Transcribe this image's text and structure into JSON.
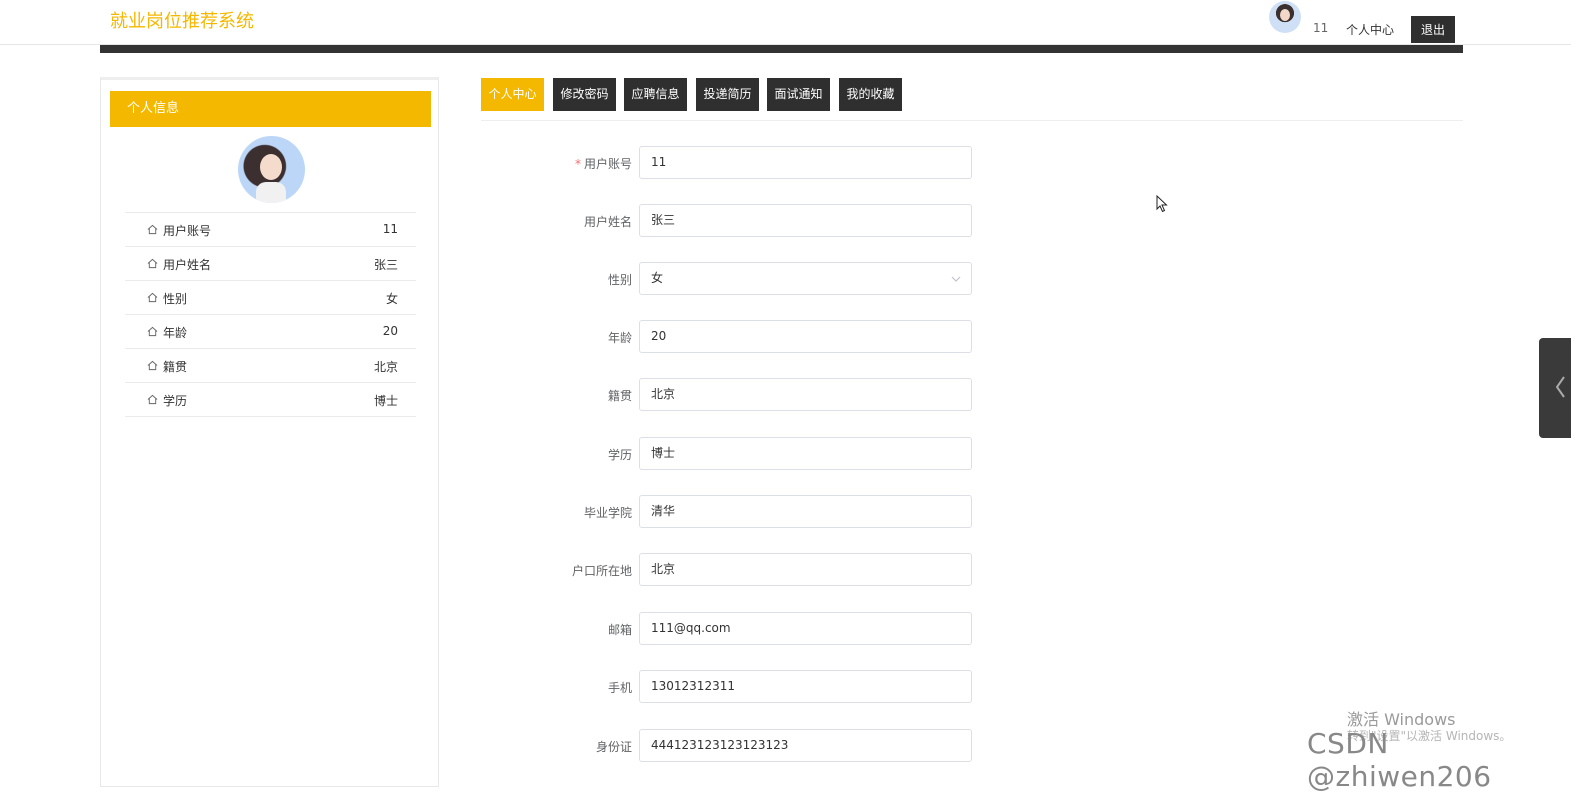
{
  "header": {
    "brand": "就业岗位推荐系统",
    "username": "11",
    "center_link": "个人中心",
    "logout_label": "退出"
  },
  "sidebar": {
    "title": "个人信息",
    "items": [
      {
        "label": "用户账号",
        "value": "11"
      },
      {
        "label": "用户姓名",
        "value": "张三"
      },
      {
        "label": "性别",
        "value": "女"
      },
      {
        "label": "年龄",
        "value": "20"
      },
      {
        "label": "籍贯",
        "value": "北京"
      },
      {
        "label": "学历",
        "value": "博士"
      }
    ]
  },
  "tabs": [
    {
      "label": "个人中心",
      "active": true
    },
    {
      "label": "修改密码",
      "active": false
    },
    {
      "label": "应聘信息",
      "active": false
    },
    {
      "label": "投递简历",
      "active": false
    },
    {
      "label": "面试通知",
      "active": false
    },
    {
      "label": "我的收藏",
      "active": false
    }
  ],
  "form": {
    "account": {
      "label": "用户账号",
      "required_mark": "*",
      "value": "11"
    },
    "name": {
      "label": "用户姓名",
      "value": "张三"
    },
    "gender": {
      "label": "性别",
      "value": "女"
    },
    "age": {
      "label": "年龄",
      "value": "20"
    },
    "native": {
      "label": "籍贯",
      "value": "北京"
    },
    "education": {
      "label": "学历",
      "value": "博士"
    },
    "school": {
      "label": "毕业学院",
      "value": "清华"
    },
    "hukou": {
      "label": "户口所在地",
      "value": "北京"
    },
    "email": {
      "label": "邮箱",
      "value": "111@qq.com"
    },
    "phone": {
      "label": "手机",
      "value": "13012312311"
    },
    "idcard": {
      "label": "身份证",
      "value": "444123123123123123"
    }
  },
  "watermark": {
    "activate_title": "激活 Windows",
    "activate_sub": "转到\"设置\"以激活 Windows。",
    "csdn": "CSDN @zhiwen206"
  },
  "colors": {
    "accent": "#f5b800",
    "dark": "#2f2f2f"
  }
}
